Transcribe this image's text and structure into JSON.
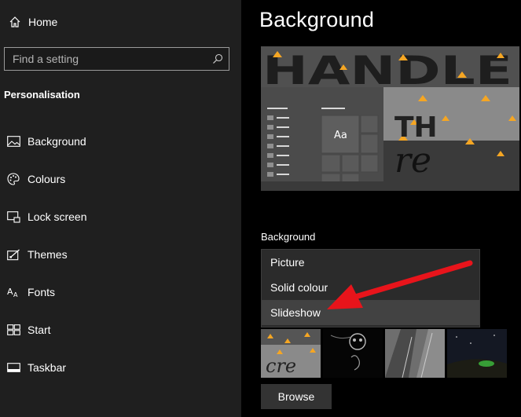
{
  "sidebar": {
    "home_label": "Home",
    "search_placeholder": "Find a setting",
    "section_title": "Personalisation",
    "items": [
      {
        "label": "Background",
        "icon": "picture-icon"
      },
      {
        "label": "Colours",
        "icon": "palette-icon"
      },
      {
        "label": "Lock screen",
        "icon": "lock-screen-icon"
      },
      {
        "label": "Themes",
        "icon": "themes-icon"
      },
      {
        "label": "Fonts",
        "icon": "fonts-icon"
      },
      {
        "label": "Start",
        "icon": "start-icon"
      },
      {
        "label": "Taskbar",
        "icon": "taskbar-icon"
      }
    ]
  },
  "main": {
    "title": "Background",
    "preview_tile_text": "Aa",
    "preview_wallpaper_text": "HANDLE",
    "background_label": "Background",
    "dropdown_options": [
      {
        "label": "Picture",
        "state": "selected"
      },
      {
        "label": "Solid colour",
        "state": "normal"
      },
      {
        "label": "Slideshow",
        "state": "hover"
      }
    ],
    "browse_label": "Browse"
  },
  "colors": {
    "sidebar_bg": "#1f1f1f",
    "content_bg": "#000000",
    "dropdown_bg": "#2b2b2b",
    "dropdown_hover": "#424242",
    "annotation_arrow": "#e8141b"
  }
}
